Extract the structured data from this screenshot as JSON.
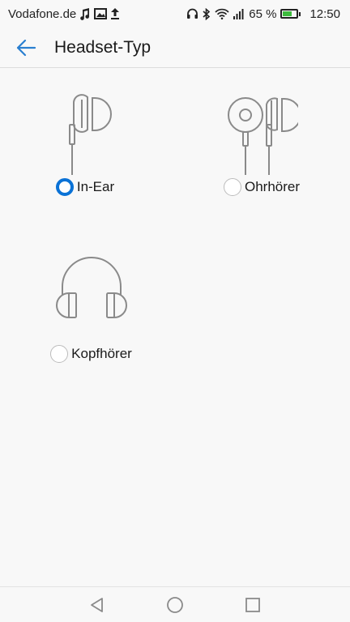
{
  "status_bar": {
    "carrier": "Vodafone.de",
    "battery_percent": "65 %",
    "battery_level": 0.65,
    "time": "12:50",
    "icons_left": [
      "music-note-icon",
      "image-icon",
      "upload-icon"
    ],
    "icons_right": [
      "headphones-icon",
      "bluetooth-icon",
      "wifi-icon",
      "signal-icon",
      "battery-icon"
    ]
  },
  "header": {
    "title": "Headset-Typ",
    "back_icon": "arrow-back-icon"
  },
  "options": [
    {
      "label": "In-Ear",
      "selected": true,
      "icon": "in-ear-headset-icon"
    },
    {
      "label": "Ohrhörer",
      "selected": false,
      "icon": "earbuds-icon"
    },
    {
      "label": "Kopfhörer",
      "selected": false,
      "icon": "over-ear-headphones-icon"
    }
  ],
  "nav_bar": {
    "icons": [
      "back-triangle-icon",
      "home-circle-icon",
      "recents-square-icon"
    ]
  },
  "colors": {
    "accent": "#0a72d6",
    "back_arrow": "#2a7fd0",
    "icon_gray": "#8a8a8a",
    "background": "#f8f8f8",
    "battery_green": "#3dbb3d"
  }
}
